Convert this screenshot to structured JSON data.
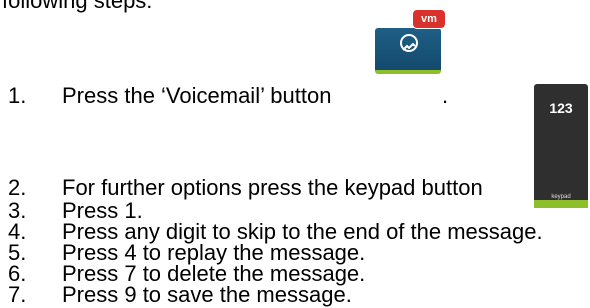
{
  "intro": "following steps:",
  "steps": [
    {
      "n": "1.",
      "text": "Press the ‘Voicemail’ button",
      "tail": "."
    },
    {
      "n": "2.",
      "text": "For further options press the keypad button"
    },
    {
      "n": "3.",
      "text": "Press 1."
    },
    {
      "n": "4.",
      "text": "Press any digit to skip to the end of the message."
    },
    {
      "n": "5.",
      "text": "Press 4 to replay the message."
    },
    {
      "n": "6.",
      "text": "Press 7 to delete the message."
    },
    {
      "n": "7.",
      "text": "Press 9 to save the message."
    }
  ],
  "voicemail_icon": {
    "badge": "vm",
    "icon": "voicemail-icon",
    "bg": "#1f5f86",
    "badge_color": "#d9322d",
    "accent": "#8dbf2a"
  },
  "keypad_icon": {
    "number": "123",
    "label": "keypad",
    "bg": "#2f2f2f",
    "accent": "#8dbf2a"
  }
}
